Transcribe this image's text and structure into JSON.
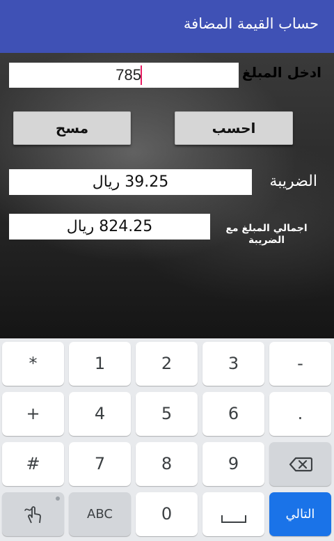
{
  "app": {
    "title": "حساب القيمة المضافة"
  },
  "form": {
    "amount_label": "ادخل المبلغ",
    "amount_value": "785",
    "calculate_label": "احسب",
    "clear_label": "مسح",
    "tax_label": "الضريبة",
    "tax_value": "39.25 ريال",
    "total_label": "اجمالي المبلغ مع الضريبة",
    "total_value": "824.25 ريال"
  },
  "keyboard": {
    "row1": [
      "*",
      "1",
      "2",
      "3",
      "-"
    ],
    "row2": [
      "+",
      "4",
      "5",
      "6",
      "."
    ],
    "row3": [
      "#",
      "7",
      "8",
      "9"
    ],
    "row4_abc": "ABC",
    "row4_zero": "0",
    "next_label": "التالي",
    "icons": {
      "backspace": "backspace-icon",
      "handwriting": "handwriting-icon",
      "space": "space-icon"
    }
  },
  "colors": {
    "appbar": "#3f51b5",
    "action_key": "#1a73e8",
    "cursor": "#e91e63"
  }
}
